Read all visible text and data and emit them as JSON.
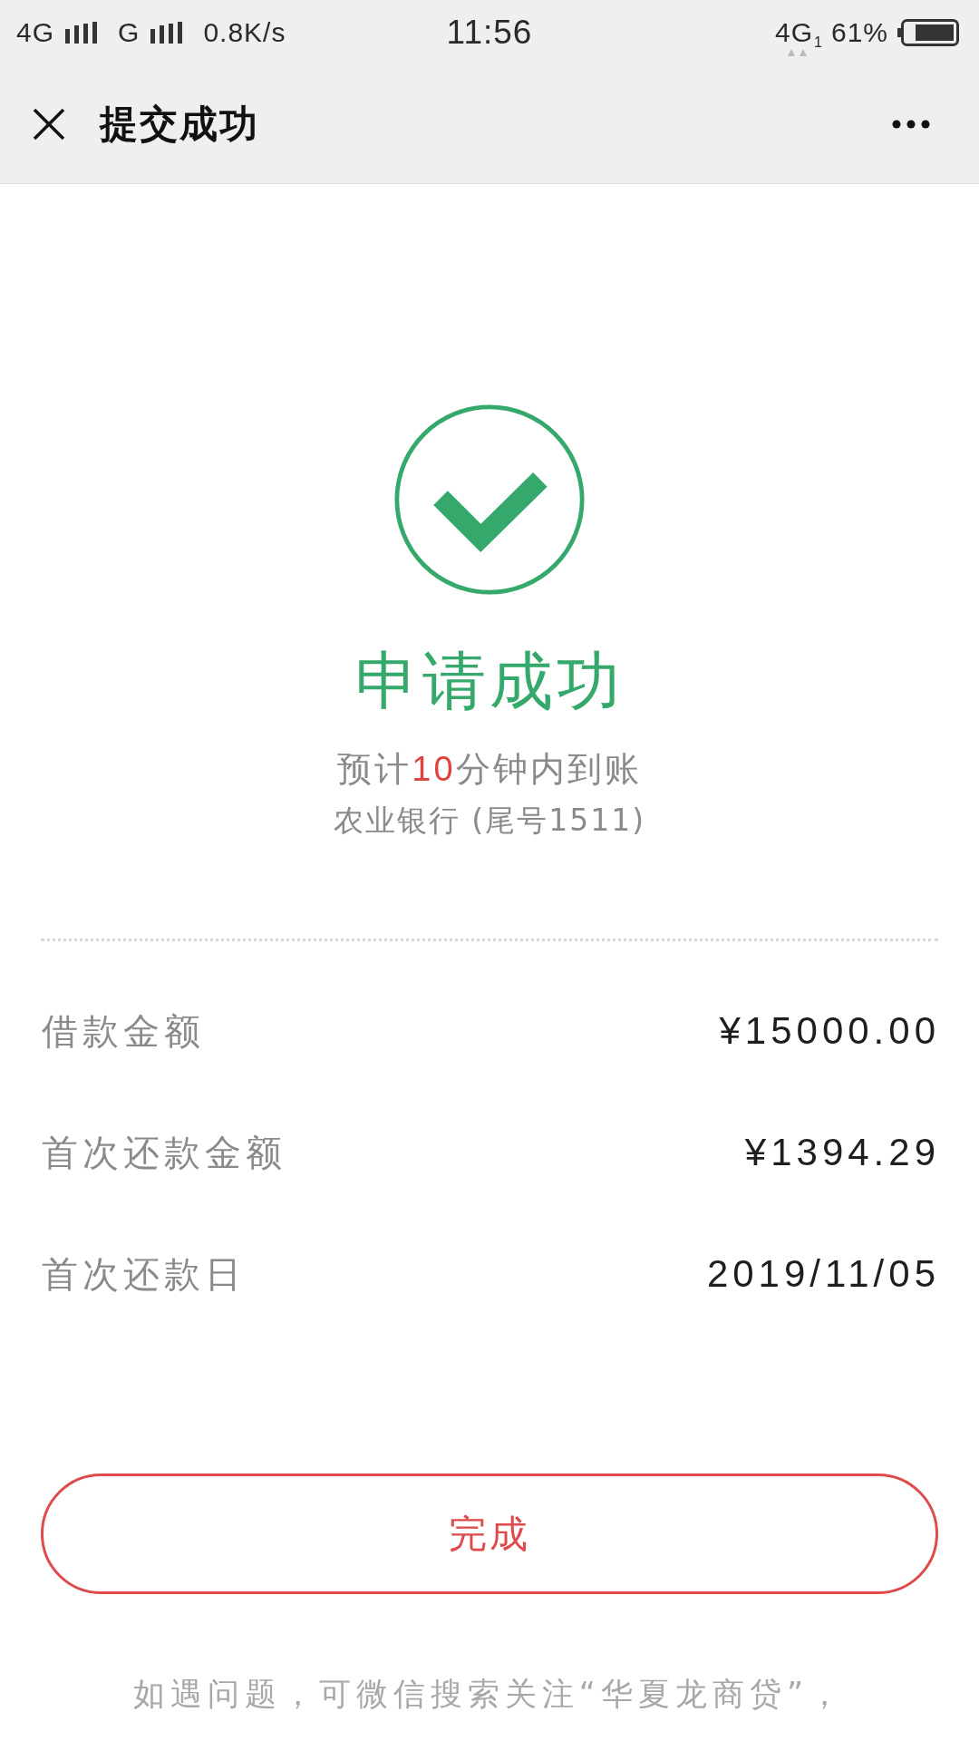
{
  "status_bar": {
    "network_1": "4G",
    "network_2": "G",
    "speed": "0.8K/s",
    "time": "11:56",
    "network_3": "4G",
    "sim_slot": "1",
    "battery": "61%"
  },
  "header": {
    "title": "提交成功"
  },
  "result": {
    "title": "申请成功",
    "eta": {
      "before": "预计",
      "highlight": "10",
      "after": "分钟内到账"
    },
    "bank": "农业银行 (尾号1511)"
  },
  "details": [
    {
      "label": "借款金额",
      "value": "¥15000.00"
    },
    {
      "label": "首次还款金额",
      "value": "¥1394.29"
    },
    {
      "label": "首次还款日",
      "value": "2019/11/05"
    }
  ],
  "button": {
    "label": "完成"
  },
  "footer_note": "如遇问题，可微信搜索关注“华夏龙商贷”，"
}
